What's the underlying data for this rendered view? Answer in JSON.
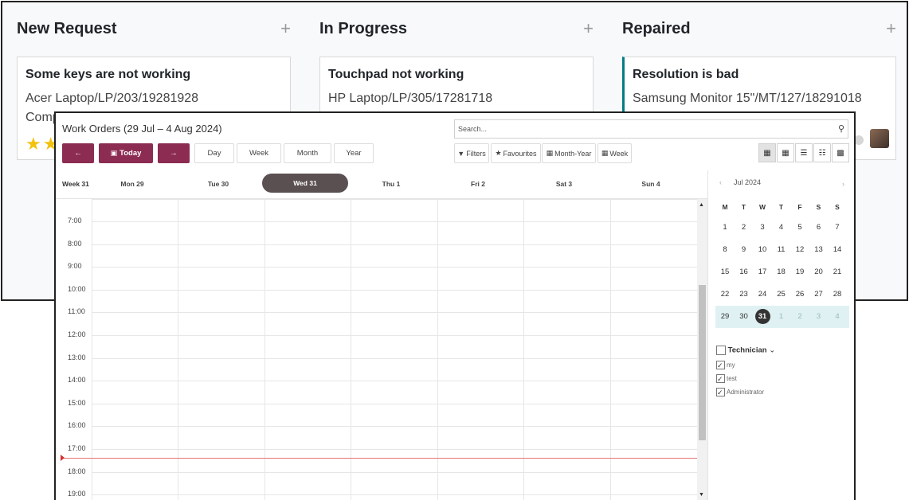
{
  "kanban": {
    "columns": [
      {
        "title": "New Request",
        "add_icon": "plus-icon",
        "card": {
          "title": "Some keys are not working",
          "line1": "Acer Laptop/LP/203/19281928",
          "line2": "Comp"
        }
      },
      {
        "title": "In Progress",
        "add_icon": "plus-icon",
        "card": {
          "title": "Touchpad not working",
          "line1": "HP Laptop/LP/305/17281718",
          "line2": ""
        }
      },
      {
        "title": "Repaired",
        "add_icon": "plus-icon",
        "card": {
          "title": "Resolution is bad",
          "line1": "Samsung Monitor 15\"/MT/127/18291018",
          "line2": ""
        }
      }
    ],
    "stars": "★★",
    "colors": {
      "accent": "#017e84",
      "star": "#f3c20e"
    }
  },
  "calendar": {
    "title": "Work Orders (29 Jul – 4 Aug 2024)",
    "nav": {
      "prev": "←",
      "today": "Today",
      "next": "→"
    },
    "scales": [
      "Day",
      "Week",
      "Month",
      "Year"
    ],
    "search": {
      "placeholder": "Search..."
    },
    "filter_buttons": {
      "filters": "Filters",
      "favourites": "Favourites",
      "group1": "Month-Year",
      "group2": "Week"
    },
    "view_icons": [
      "calendar-icon",
      "kanban-icon",
      "list-icon",
      "pivot-icon",
      "graph-icon"
    ],
    "week_label": "Week 31",
    "days": [
      "Mon 29",
      "Tue 30",
      "Wed 31",
      "Thu 1",
      "Fri 2",
      "Sat 3",
      "Sun 4"
    ],
    "today_index": 2,
    "hours": [
      "7:00",
      "8:00",
      "9:00",
      "10:00",
      "11:00",
      "12:00",
      "13:00",
      "14:00",
      "15:00",
      "16:00",
      "17:00",
      "18:00",
      "19:00"
    ],
    "colors": {
      "primary": "#8c2c52",
      "today_pill": "#5a5052",
      "now_line": "#e57373"
    }
  },
  "mini_calendar": {
    "month_label": "Jul 2024",
    "prev": "‹",
    "next": "›",
    "dow": [
      "M",
      "T",
      "W",
      "T",
      "F",
      "S",
      "S"
    ],
    "weeks": [
      [
        "1",
        "2",
        "3",
        "4",
        "5",
        "6",
        "7"
      ],
      [
        "8",
        "9",
        "10",
        "11",
        "12",
        "13",
        "14"
      ],
      [
        "15",
        "16",
        "17",
        "18",
        "19",
        "20",
        "21"
      ],
      [
        "22",
        "23",
        "24",
        "25",
        "26",
        "27",
        "28"
      ],
      [
        "29",
        "30",
        "31",
        "1",
        "2",
        "3",
        "4"
      ]
    ],
    "selected": "31"
  },
  "technician_filter": {
    "label": "Technician",
    "items": [
      {
        "label": "my",
        "checked": true
      },
      {
        "label": "test",
        "checked": true
      },
      {
        "label": "Administrator",
        "checked": true
      }
    ]
  }
}
